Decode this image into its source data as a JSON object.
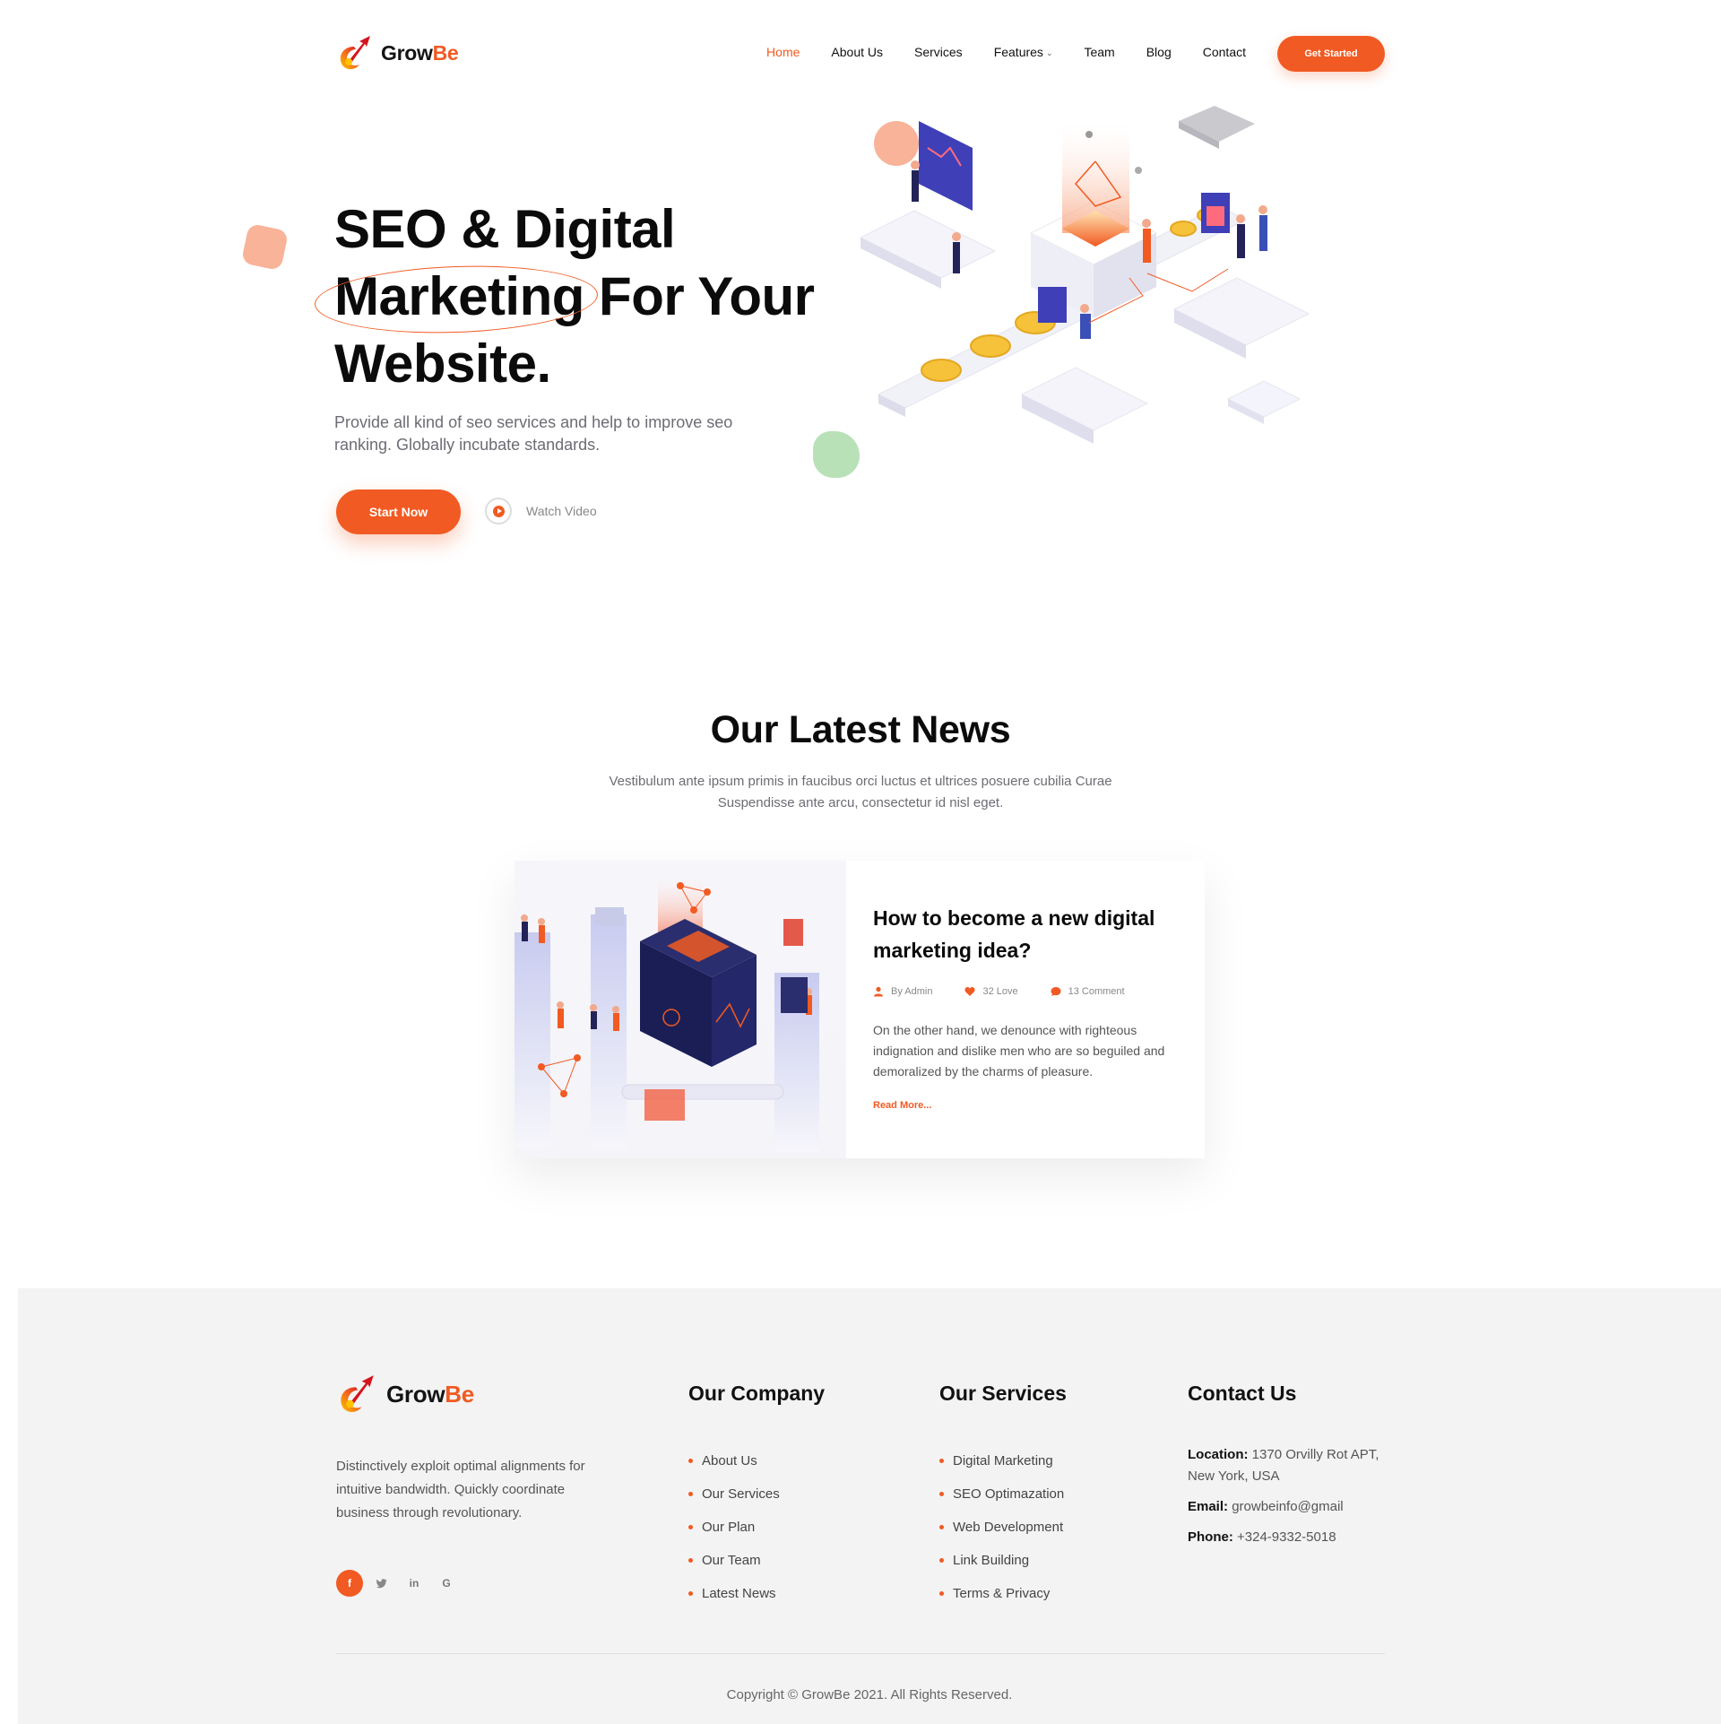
{
  "brand": {
    "name_part1": "Grow",
    "name_part2": "Be",
    "accent": "#f15a22"
  },
  "nav": {
    "items": [
      {
        "label": "Home",
        "active": true
      },
      {
        "label": "About Us"
      },
      {
        "label": "Services"
      },
      {
        "label": "Features",
        "has_dropdown": true
      },
      {
        "label": "Team"
      },
      {
        "label": "Blog"
      },
      {
        "label": "Contact"
      }
    ],
    "cta": "Get Started"
  },
  "hero": {
    "title_line1": "SEO & Digital",
    "title_word_highlight": "Marketing",
    "title_rest_line2": " For Your",
    "title_line3": "Website.",
    "subtitle": "Provide all kind of seo services and help to improve seo ranking. Globally incubate standards.",
    "start_button": "Start Now",
    "watch_label": "Watch Video"
  },
  "news": {
    "title": "Our Latest News",
    "subtitle": "Vestibulum ante ipsum primis in faucibus orci luctus et ultrices posuere cubilia Curae Suspendisse ante arcu, consectetur id nisl eget.",
    "post": {
      "title": "How to become a new digital marketing idea?",
      "author": "By Admin",
      "love": "32 Love",
      "comments": "13 Comment",
      "excerpt": "On the other hand, we denounce with righteous indignation and dislike men who are so beguiled and demoralized by the charms of pleasure.",
      "read_more": "Read More..."
    }
  },
  "footer": {
    "description": "Distinctively exploit optimal alignments for intuitive bandwidth. Quickly coordinate business through revolutionary.",
    "social": [
      "facebook-icon",
      "twitter-icon",
      "linkedin-icon",
      "google-icon"
    ],
    "company": {
      "title": "Our Company",
      "links": [
        "About Us",
        "Our Services",
        "Our Plan",
        "Our Team",
        "Latest News"
      ]
    },
    "services": {
      "title": "Our Services",
      "links": [
        "Digital Marketing",
        "SEO Optimazation",
        "Web Development",
        "Link Building",
        "Terms & Privacy"
      ]
    },
    "contact": {
      "title": "Contact Us",
      "location_label": "Location:",
      "location": "1370 Orvilly Rot APT, New York, USA",
      "email_label": "Email:",
      "email": "growbeinfo@gmail",
      "phone_label": "Phone:",
      "phone": "+324-9332-5018"
    },
    "copyright": "Copyright © GrowBe 2021. All Rights Reserved."
  }
}
